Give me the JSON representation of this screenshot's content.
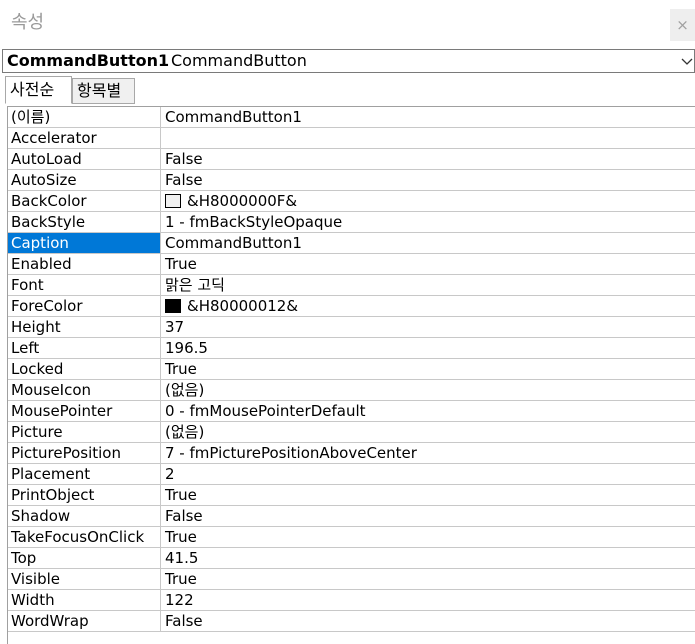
{
  "window": {
    "title": "속성",
    "close_label": "×"
  },
  "object_selector": {
    "name": "CommandButton1",
    "type": "CommandButton"
  },
  "tabs": [
    {
      "label": "사전순",
      "active": true
    },
    {
      "label": "항목별",
      "active": false
    }
  ],
  "properties": [
    {
      "name": "(이름)",
      "value": "CommandButton1"
    },
    {
      "name": "Accelerator",
      "value": ""
    },
    {
      "name": "AutoLoad",
      "value": "False"
    },
    {
      "name": "AutoSize",
      "value": "False"
    },
    {
      "name": "BackColor",
      "value": "&H8000000F&",
      "swatch": "#f0f0f0"
    },
    {
      "name": "BackStyle",
      "value": "1 - fmBackStyleOpaque"
    },
    {
      "name": "Caption",
      "value": "CommandButton1",
      "selected": true
    },
    {
      "name": "Enabled",
      "value": "True"
    },
    {
      "name": "Font",
      "value": "맑은 고딕"
    },
    {
      "name": "ForeColor",
      "value": "&H80000012&",
      "swatch": "#000000"
    },
    {
      "name": "Height",
      "value": "37"
    },
    {
      "name": "Left",
      "value": "196.5"
    },
    {
      "name": "Locked",
      "value": "True"
    },
    {
      "name": "MouseIcon",
      "value": "(없음)"
    },
    {
      "name": "MousePointer",
      "value": "0 - fmMousePointerDefault"
    },
    {
      "name": "Picture",
      "value": "(없음)"
    },
    {
      "name": "PicturePosition",
      "value": "7 - fmPicturePositionAboveCenter"
    },
    {
      "name": "Placement",
      "value": "2"
    },
    {
      "name": "PrintObject",
      "value": "True"
    },
    {
      "name": "Shadow",
      "value": "False"
    },
    {
      "name": "TakeFocusOnClick",
      "value": "True"
    },
    {
      "name": "Top",
      "value": "41.5"
    },
    {
      "name": "Visible",
      "value": "True"
    },
    {
      "name": "Width",
      "value": "122"
    },
    {
      "name": "WordWrap",
      "value": "False"
    }
  ],
  "colors": {
    "selection": "#0078d7",
    "grid_line": "#c8c8c8"
  }
}
